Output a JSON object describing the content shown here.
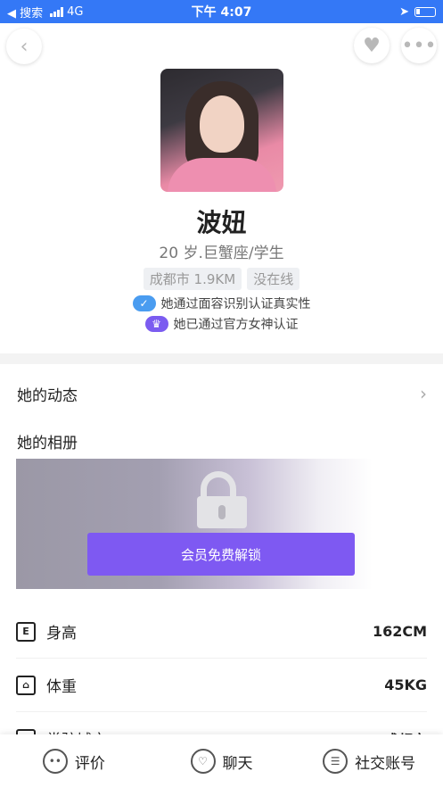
{
  "status_bar": {
    "back_label": "◀ 搜索",
    "network": "4G",
    "time": "下午 4:07"
  },
  "topbar": {
    "back_icon": "chevron-left-icon",
    "heart_icon": "heart-icon",
    "more_icon": "more-dots-icon"
  },
  "profile": {
    "name": "波妞",
    "subtitle": "20 岁.巨蟹座/学生",
    "tags": [
      "成都市 1.9KM",
      "没在线"
    ],
    "verify_face": "她通过面容识别认证真实性",
    "verify_goddess": "她已通过官方女神认证"
  },
  "sections": {
    "dynamics": "她的动态",
    "album": "她的相册",
    "unlock_button": "会员免费解锁"
  },
  "info": {
    "height_label": "身高",
    "height_value": "162CM",
    "weight_label": "体重",
    "weight_value": "45KG",
    "city_label": "常驻城市",
    "city_value": "成都市"
  },
  "tabbar": {
    "review": "评价",
    "chat": "聊天",
    "social": "社交账号"
  }
}
